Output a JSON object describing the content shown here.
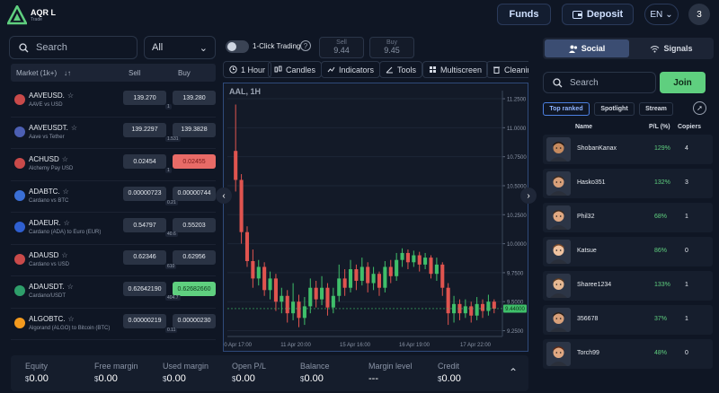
{
  "header": {
    "brand_name": "AQR L",
    "brand_sub": "Trade",
    "funds_label": "Funds",
    "deposit_label": "Deposit",
    "language": "EN",
    "notification_count": "3"
  },
  "market": {
    "search_placeholder": "Search",
    "filter_value": "All",
    "columns": {
      "market": "Market (1k+)",
      "sort": "↓↑",
      "sell": "Sell",
      "buy": "Buy"
    },
    "rows": [
      {
        "symbol": "AAVEUSD.",
        "desc": "AAVE vs USD",
        "sell": "139.270",
        "buy": "139.280",
        "spread": "1",
        "flag_color": "#c94a4a",
        "buy_state": "normal"
      },
      {
        "symbol": "AAVEUSDT.",
        "desc": "Aave vs Tether",
        "sell": "139.2297",
        "buy": "139.3828",
        "spread": "1.531",
        "flag_color": "#4c5fb3",
        "buy_state": "normal"
      },
      {
        "symbol": "ACHUSD",
        "desc": "Alchemy Pay USD",
        "sell": "0.02454",
        "buy": "0.02455",
        "spread": "1",
        "flag_color": "#c94a4a",
        "buy_state": "red"
      },
      {
        "symbol": "ADABTC.",
        "desc": "Cardano vs BTC",
        "sell": "0.00000723",
        "buy": "0.00000744",
        "spread": "0.21",
        "flag_color": "#3a6fd6",
        "buy_state": "normal"
      },
      {
        "symbol": "ADAEUR.",
        "desc": "Cardano (ADA) to Euro (EUR)",
        "sell": "0.54797",
        "buy": "0.55203",
        "spread": "40.6",
        "flag_color": "#2f5fd0",
        "buy_state": "normal"
      },
      {
        "symbol": "ADAUSD",
        "desc": "Cardano vs USD",
        "sell": "0.62346",
        "buy": "0.62956",
        "spread": "610",
        "flag_color": "#c94a4a",
        "buy_state": "normal"
      },
      {
        "symbol": "ADAUSDT.",
        "desc": "Cardano/USDT",
        "sell": "0.62642190",
        "buy": "0.62682660",
        "spread": "404.7",
        "flag_color": "#2e9e6a",
        "buy_state": "green"
      },
      {
        "symbol": "ALGOBTC.",
        "desc": "Algorand (ALGO) to Bitcoin (BTC)",
        "sell": "0.00000219",
        "buy": "0.00000230",
        "spread": "0.11",
        "flag_color": "#f39a1e",
        "buy_state": "normal"
      }
    ]
  },
  "account": {
    "currency": "$",
    "stats": [
      {
        "label": "Equity",
        "value": "0.00",
        "has_currency": true
      },
      {
        "label": "Free margin",
        "value": "0.00",
        "has_currency": true
      },
      {
        "label": "Used margin",
        "value": "0.00",
        "has_currency": true
      },
      {
        "label": "Open P/L",
        "value": "0.00",
        "has_currency": true
      },
      {
        "label": "Balance",
        "value": "0.00",
        "has_currency": true
      },
      {
        "label": "Margin level",
        "value": "---",
        "has_currency": false
      },
      {
        "label": "Credit",
        "value": "0.00",
        "has_currency": true
      }
    ]
  },
  "trade_bar": {
    "one_click_label": "1-Click Trading",
    "sell_label": "Sell",
    "sell_value": "9.44",
    "buy_label": "Buy",
    "buy_value": "9.45"
  },
  "chart_toolbar": {
    "interval": "1 Hour",
    "candles": "Candles",
    "indicators": "Indicators",
    "tools": "Tools",
    "multiscreen": "Multiscreen",
    "cleaning": "Cleaning"
  },
  "chart_data": {
    "type": "candlestick",
    "title": "AAL, 1H",
    "y_ticks": [
      "11.2500",
      "11.0000",
      "10.7500",
      "10.5000",
      "10.2500",
      "10.0000",
      "9.7500",
      "9.5000",
      "9.2500"
    ],
    "ylim": [
      9.2,
      11.32
    ],
    "x_ticks": [
      "10 Apr 17:00",
      "11 Apr 20:00",
      "15 Apr 16:00",
      "16 Apr 19:00",
      "17 Apr 22:00"
    ],
    "last_price": "9.44000",
    "last_value": 9.44,
    "candles": [
      {
        "o": 10.8,
        "c": 10.55,
        "h": 11.2,
        "l": 10.45
      },
      {
        "o": 10.55,
        "c": 10.1,
        "h": 10.6,
        "l": 10.0
      },
      {
        "o": 10.1,
        "c": 9.85,
        "h": 10.15,
        "l": 9.8
      },
      {
        "o": 9.85,
        "c": 9.7,
        "h": 9.95,
        "l": 9.62
      },
      {
        "o": 9.7,
        "c": 9.8,
        "h": 9.86,
        "l": 9.64
      },
      {
        "o": 9.8,
        "c": 9.6,
        "h": 9.84,
        "l": 9.55
      },
      {
        "o": 9.6,
        "c": 9.7,
        "h": 9.76,
        "l": 9.52
      },
      {
        "o": 9.7,
        "c": 9.5,
        "h": 9.74,
        "l": 9.42
      },
      {
        "o": 9.5,
        "c": 9.55,
        "h": 9.62,
        "l": 9.4
      },
      {
        "o": 9.55,
        "c": 9.4,
        "h": 9.6,
        "l": 9.32
      },
      {
        "o": 9.4,
        "c": 9.5,
        "h": 9.66,
        "l": 9.34
      },
      {
        "o": 9.5,
        "c": 9.36,
        "h": 9.56,
        "l": 9.28
      },
      {
        "o": 9.36,
        "c": 9.46,
        "h": 9.54,
        "l": 9.3
      },
      {
        "o": 9.46,
        "c": 9.62,
        "h": 9.7,
        "l": 9.4
      },
      {
        "o": 9.62,
        "c": 9.52,
        "h": 9.68,
        "l": 9.45
      },
      {
        "o": 9.52,
        "c": 9.62,
        "h": 9.72,
        "l": 9.47
      },
      {
        "o": 9.62,
        "c": 9.45,
        "h": 9.66,
        "l": 9.38
      },
      {
        "o": 9.45,
        "c": 9.55,
        "h": 9.62,
        "l": 9.4
      },
      {
        "o": 9.55,
        "c": 9.7,
        "h": 9.82,
        "l": 9.5
      },
      {
        "o": 9.7,
        "c": 9.62,
        "h": 9.78,
        "l": 9.55
      },
      {
        "o": 9.62,
        "c": 9.78,
        "h": 9.86,
        "l": 9.58
      },
      {
        "o": 9.78,
        "c": 9.68,
        "h": 9.82,
        "l": 9.6
      },
      {
        "o": 9.68,
        "c": 9.8,
        "h": 9.88,
        "l": 9.64
      },
      {
        "o": 9.8,
        "c": 9.66,
        "h": 9.84,
        "l": 9.58
      },
      {
        "o": 9.66,
        "c": 9.74,
        "h": 9.8,
        "l": 9.6
      },
      {
        "o": 9.74,
        "c": 9.62,
        "h": 9.76,
        "l": 9.55
      },
      {
        "o": 9.62,
        "c": 9.8,
        "h": 9.85,
        "l": 9.58
      },
      {
        "o": 9.8,
        "c": 9.72,
        "h": 9.86,
        "l": 9.66
      },
      {
        "o": 9.72,
        "c": 9.86,
        "h": 9.92,
        "l": 9.68
      },
      {
        "o": 9.86,
        "c": 9.92,
        "h": 9.96,
        "l": 9.8
      },
      {
        "o": 9.92,
        "c": 9.84,
        "h": 9.95,
        "l": 9.78
      },
      {
        "o": 9.84,
        "c": 9.9,
        "h": 9.94,
        "l": 9.8
      },
      {
        "o": 9.9,
        "c": 9.82,
        "h": 9.93,
        "l": 9.76
      },
      {
        "o": 9.82,
        "c": 9.88,
        "h": 9.92,
        "l": 9.78
      },
      {
        "o": 9.88,
        "c": 9.74,
        "h": 9.9,
        "l": 9.7
      },
      {
        "o": 9.74,
        "c": 9.82,
        "h": 9.88,
        "l": 9.68
      },
      {
        "o": 9.82,
        "c": 9.62,
        "h": 9.84,
        "l": 9.55
      },
      {
        "o": 9.62,
        "c": 9.4,
        "h": 9.66,
        "l": 9.3
      },
      {
        "o": 9.4,
        "c": 9.48,
        "h": 9.55,
        "l": 9.32
      },
      {
        "o": 9.48,
        "c": 9.4,
        "h": 9.52,
        "l": 9.34
      },
      {
        "o": 9.4,
        "c": 9.46,
        "h": 9.52,
        "l": 9.36
      },
      {
        "o": 9.46,
        "c": 9.38,
        "h": 9.5,
        "l": 9.32
      },
      {
        "o": 9.38,
        "c": 9.48,
        "h": 9.54,
        "l": 9.34
      },
      {
        "o": 9.48,
        "c": 9.42,
        "h": 9.52,
        "l": 9.36
      },
      {
        "o": 9.42,
        "c": 9.5,
        "h": 9.56,
        "l": 9.38
      },
      {
        "o": 9.5,
        "c": 9.44,
        "h": 9.52,
        "l": 9.4
      }
    ]
  },
  "social": {
    "tab_social": "Social",
    "tab_signals": "Signals",
    "search_placeholder": "Search",
    "join_label": "Join",
    "chips": [
      "Top ranked",
      "Spotlight",
      "Stream"
    ],
    "columns": {
      "name": "Name",
      "pl": "P/L (%)",
      "copiers": "Copiers"
    },
    "traders": [
      {
        "name": "ShobanKanax",
        "pl": "129%",
        "copiers": "4",
        "skin": "#c58a5f",
        "hair": "#1f140e"
      },
      {
        "name": "Hasko351",
        "pl": "132%",
        "copiers": "3",
        "skin": "#d8a07a",
        "hair": "#3a2a20"
      },
      {
        "name": "Phil32",
        "pl": "68%",
        "copiers": "1",
        "skin": "#e0a882",
        "hair": "#3a2a20"
      },
      {
        "name": "Katsue",
        "pl": "86%",
        "copiers": "0",
        "skin": "#f0c3a0",
        "hair": "#7a4a2a"
      },
      {
        "name": "Sharee1234",
        "pl": "133%",
        "copiers": "1",
        "skin": "#e6b892",
        "hair": "#5a3a22"
      },
      {
        "name": "356678",
        "pl": "37%",
        "copiers": "1",
        "skin": "#d8a07a",
        "hair": "#2a1e16"
      },
      {
        "name": "Torch99",
        "pl": "48%",
        "copiers": "0",
        "skin": "#e0a882",
        "hair": "#5a2a18"
      }
    ]
  }
}
